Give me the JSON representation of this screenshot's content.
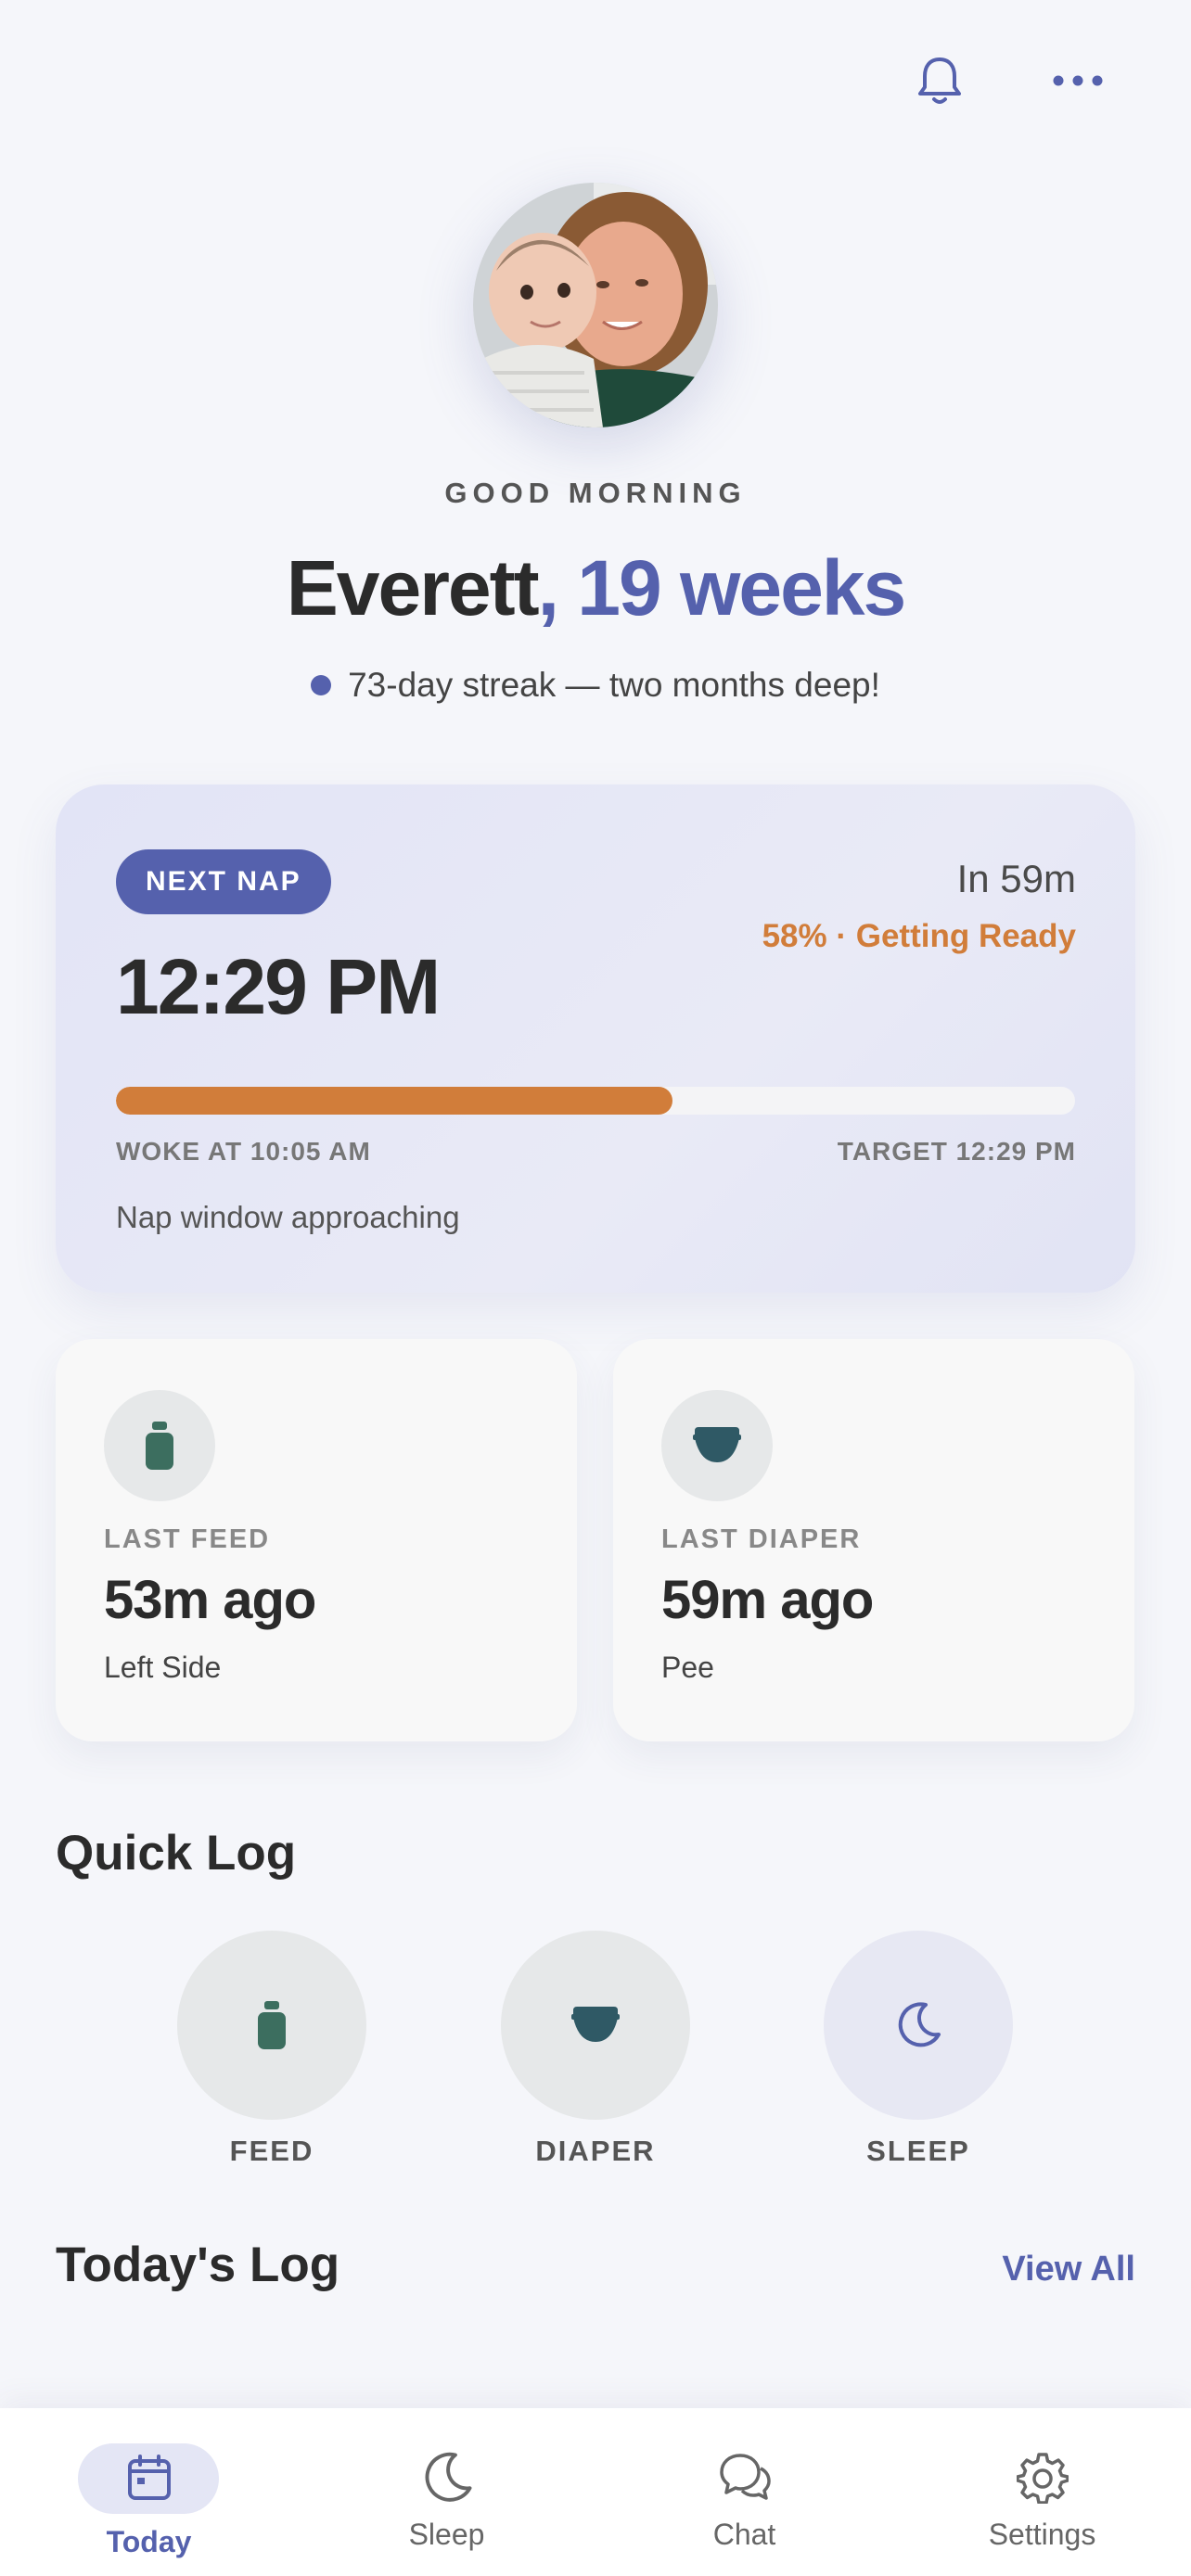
{
  "header": {
    "bell_icon": "bell-icon",
    "more_icon": "more-horizontal-icon"
  },
  "hero": {
    "greeting": "GOOD MORNING",
    "name": "Everett",
    "age": ", 19 weeks",
    "streak": "73-day streak — two months deep!"
  },
  "next_nap": {
    "badge": "NEXT NAP",
    "time": "12:29 PM",
    "countdown": "In 59m",
    "status": "58% · Getting Ready",
    "progress_percent": 58,
    "woke": "WOKE AT 10:05 AM",
    "target": "TARGET 12:29 PM",
    "note": "Nap window approaching"
  },
  "stats": [
    {
      "label": "LAST FEED",
      "value": "53m ago",
      "sub": "Left Side",
      "icon": "bottle-icon"
    },
    {
      "label": "LAST DIAPER",
      "value": "59m ago",
      "sub": "Pee",
      "icon": "diaper-icon"
    }
  ],
  "quick_log": {
    "title": "Quick Log",
    "items": [
      {
        "label": "FEED",
        "icon": "bottle-icon"
      },
      {
        "label": "DIAPER",
        "icon": "diaper-icon"
      },
      {
        "label": "SLEEP",
        "icon": "moon-icon"
      }
    ]
  },
  "todays_log": {
    "title": "Today's Log",
    "view_all": "View All"
  },
  "nav": {
    "items": [
      {
        "label": "Today",
        "icon": "calendar-icon",
        "active": true
      },
      {
        "label": "Sleep",
        "icon": "moon-icon",
        "active": false
      },
      {
        "label": "Chat",
        "icon": "chat-icon",
        "active": false
      },
      {
        "label": "Settings",
        "icon": "gear-icon",
        "active": false
      }
    ]
  },
  "colors": {
    "accent": "#5561ad",
    "warning": "#d17d3a",
    "background": "#f5f6fa"
  }
}
